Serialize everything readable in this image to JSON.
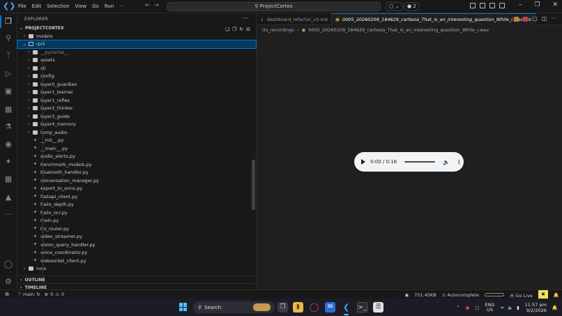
{
  "titlebar": {
    "menu": [
      "File",
      "Edit",
      "Selection",
      "View",
      "Go",
      "Run",
      "···"
    ],
    "search_text": "ProjectCortex",
    "copilot_count": "2"
  },
  "explorer": {
    "header": "EXPLORER",
    "project": "PROJECTCORTEX",
    "items": [
      {
        "name": "models",
        "kind": "folder",
        "level": 1,
        "open": false
      },
      {
        "name": "rpi5",
        "kind": "folder",
        "level": 1,
        "open": true,
        "selected": true
      },
      {
        "name": "__pycache__",
        "kind": "folder",
        "level": 2,
        "open": false,
        "dim": true
      },
      {
        "name": "assets",
        "kind": "folder",
        "level": 2,
        "open": false
      },
      {
        "name": "cli",
        "kind": "folder",
        "level": 2,
        "open": false
      },
      {
        "name": "config",
        "kind": "folder",
        "level": 2,
        "open": false
      },
      {
        "name": "layer0_guardian",
        "kind": "folder",
        "level": 2,
        "open": false
      },
      {
        "name": "layer1_learner",
        "kind": "folder",
        "level": 2,
        "open": false
      },
      {
        "name": "layer1_reflex",
        "kind": "folder",
        "level": 2,
        "open": false
      },
      {
        "name": "layer2_thinker",
        "kind": "folder",
        "level": 2,
        "open": false
      },
      {
        "name": "layer3_guide",
        "kind": "folder",
        "level": 2,
        "open": false
      },
      {
        "name": "layer4_memory",
        "kind": "folder",
        "level": 2,
        "open": false
      },
      {
        "name": "temp_audio",
        "kind": "folder",
        "level": 2,
        "open": false
      },
      {
        "name": "__init__.py",
        "kind": "py",
        "level": 2
      },
      {
        "name": "__main__.py",
        "kind": "py",
        "level": 2
      },
      {
        "name": "audio_alerts.py",
        "kind": "py",
        "level": 2
      },
      {
        "name": "benchmark_models.py",
        "kind": "py",
        "level": 2
      },
      {
        "name": "bluetooth_handler.py",
        "kind": "py",
        "level": 2
      },
      {
        "name": "conversation_manager.py",
        "kind": "py",
        "level": 2
      },
      {
        "name": "export_to_onnx.py",
        "kind": "py",
        "level": 2
      },
      {
        "name": "fastapi_client.py",
        "kind": "py",
        "level": 2
      },
      {
        "name": "hailo_depth.py",
        "kind": "py",
        "level": 2
      },
      {
        "name": "hailo_ocr.py",
        "kind": "py",
        "level": 2
      },
      {
        "name": "main.py",
        "kind": "py",
        "level": 2
      },
      {
        "name": "tts_router.py",
        "kind": "py",
        "level": 2
      },
      {
        "name": "video_streamer.py",
        "kind": "py",
        "level": 2
      },
      {
        "name": "vision_query_handler.py",
        "kind": "py",
        "level": 2
      },
      {
        "name": "voice_coordinator.py",
        "kind": "py",
        "level": 2
      },
      {
        "name": "websocket_client.py",
        "kind": "py",
        "level": 2
      },
      {
        "name": "runs",
        "kind": "folder",
        "level": 1,
        "open": false
      }
    ],
    "outline": "OUTLINE",
    "timeline": "TIMELINE"
  },
  "editor": {
    "tabs": [
      {
        "label": "dashboard_refactor_v3.md",
        "active": false
      },
      {
        "label": "0005_20260209_184629_cartesia_That_is_an_interesting_question_While_I.wav",
        "active": true
      }
    ],
    "breadcrumb": [
      "tts_recordings",
      "0005_20260209_184629_cartesia_That_is_an_interesting_question_While_I.wav"
    ],
    "player": {
      "time": "0:00 / 0:16",
      "progress": 0
    }
  },
  "statusbar": {
    "branch": "main",
    "errors": "0",
    "warnings": "0",
    "size": "751.45KB",
    "autocomplete": "Autocomplete",
    "golive": "Go Live"
  },
  "taskbar": {
    "search": "Search",
    "lang_top": "ENG",
    "lang_bottom": "US",
    "time": "11:57 pm",
    "date": "9/2/2026"
  }
}
